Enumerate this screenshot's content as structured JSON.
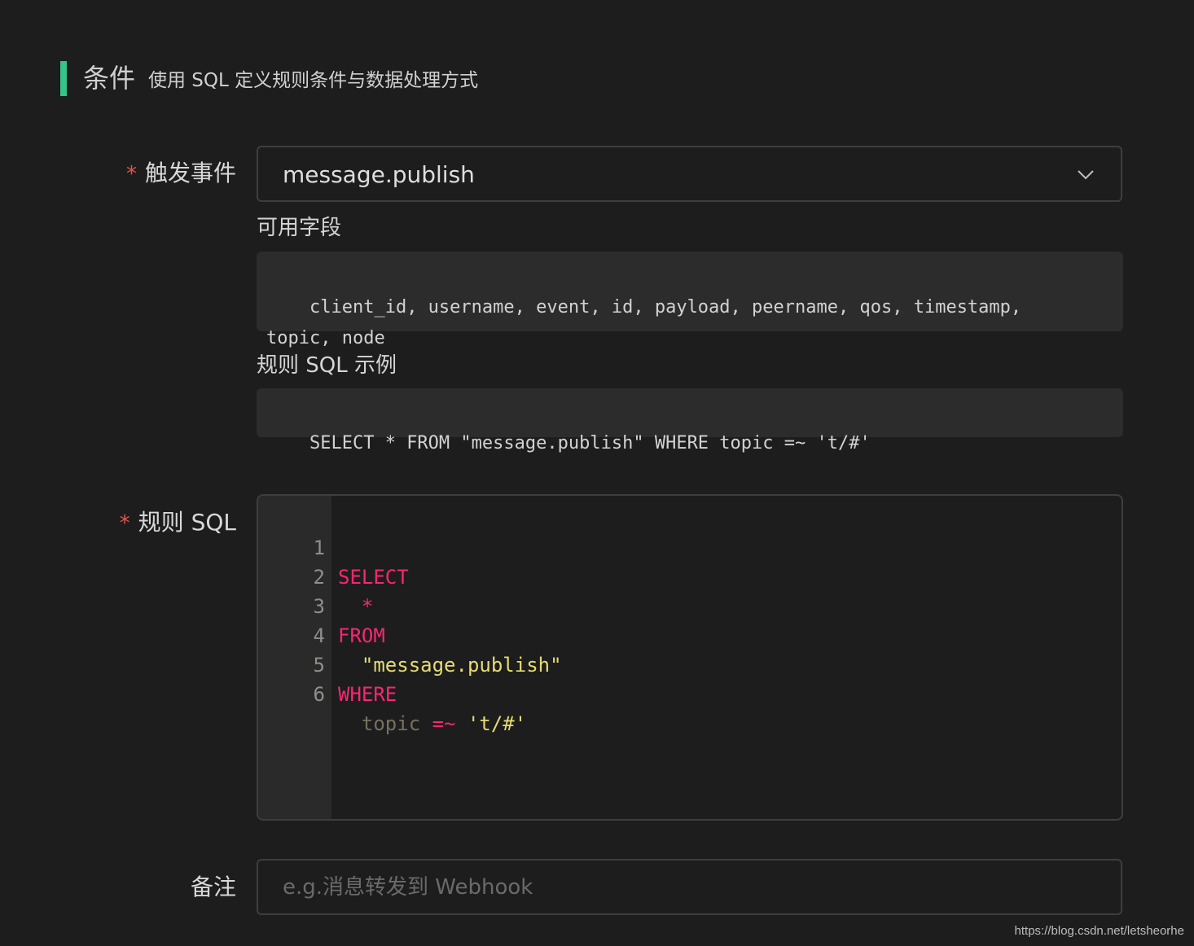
{
  "section": {
    "title": "条件",
    "subtitle": "使用 SQL 定义规则条件与数据处理方式"
  },
  "trigger": {
    "required_mark": "*",
    "label": "触发事件",
    "value": "message.publish"
  },
  "fields": {
    "heading": "可用字段",
    "text": "client_id, username, event, id, payload, peername, qos, timestamp, topic, node"
  },
  "example": {
    "heading": "规则 SQL 示例",
    "sql": "SELECT * FROM \"message.publish\" WHERE topic =~ 't/#'"
  },
  "rule_sql": {
    "required_mark": "*",
    "label": "规则 SQL",
    "lines": [
      {
        "num": "1",
        "t1": "SELECT"
      },
      {
        "num": "2",
        "t1": "  *"
      },
      {
        "num": "3",
        "t1": "FROM"
      },
      {
        "num": "4",
        "t1": "  \"message.publish\""
      },
      {
        "num": "5",
        "t1": "WHERE"
      },
      {
        "num": "6",
        "t1": "  topic",
        "t2": " =~ ",
        "t3": "'t/#'"
      }
    ]
  },
  "remark": {
    "label": "备注",
    "placeholder": "e.g.消息转发到 Webhook",
    "value": ""
  },
  "watermark": "https://blog.csdn.net/letsheorhe",
  "colors": {
    "accent": "#34c388",
    "required": "#e2564f",
    "keyword": "#f92672",
    "string": "#e6db74",
    "identifier": "#75715e"
  }
}
